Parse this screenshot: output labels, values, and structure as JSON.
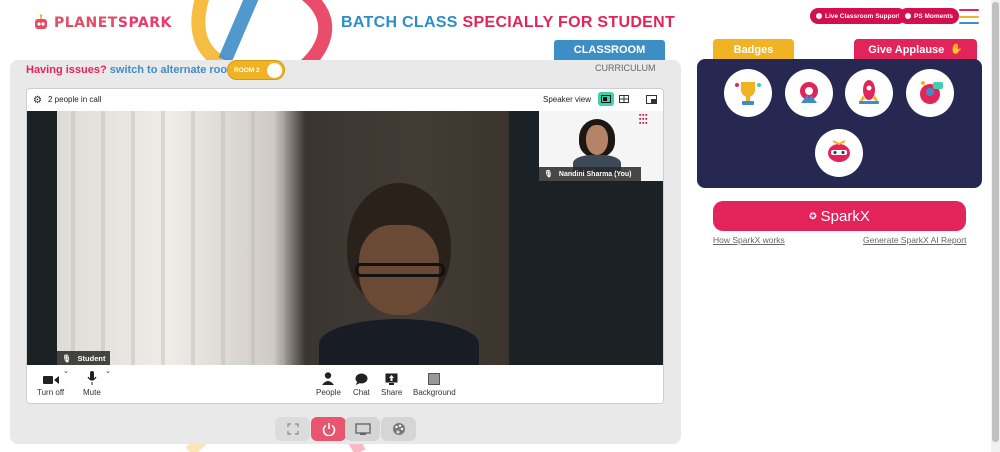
{
  "header": {
    "logo_part1": "PLANET",
    "logo_part2": "SPARK",
    "title_part1": "BATCH CLASS",
    "title_part2": "SPECIALLY FOR STUDENT",
    "live_support_label": "Live Classroom Support",
    "ps_moments_label": "PS Moments"
  },
  "tabs": {
    "classroom": "CLASSROOM",
    "curriculum": "CURRICULUM"
  },
  "issues": {
    "text": "Having issues?",
    "link": "switch to alternate room",
    "room_label": "ROOM 2"
  },
  "call": {
    "people_count": "2 people in call",
    "speaker_view_label": "Speaker view",
    "main_participant": "Student",
    "self_participant": "Nandini Sharma (You)"
  },
  "toolbar": {
    "camera_label": "Turn off",
    "mute_label": "Mute",
    "people_label": "People",
    "chat_label": "Chat",
    "share_label": "Share",
    "background_label": "Background"
  },
  "right_panel": {
    "badges_tab": "Badges",
    "applause_tab": "Give Applause",
    "sparkx_label": "SparkX",
    "how_sparkx": "How SparkX works",
    "generate_report": "Generate SparkX AI Report"
  },
  "colors": {
    "brand_pink": "#e3245b",
    "brand_blue": "#3e8ec6",
    "room_yellow": "#f0b323",
    "badge_panel": "#262852"
  },
  "icons": [
    "gear-icon",
    "speaker-view-icon",
    "grid-view-icon",
    "pip-toggle-icon",
    "mic-icon",
    "camera-icon",
    "people-icon",
    "chat-icon",
    "share-icon",
    "background-icon",
    "fullscreen-icon",
    "power-icon",
    "screen-icon",
    "palette-icon",
    "hamburger-icon"
  ]
}
